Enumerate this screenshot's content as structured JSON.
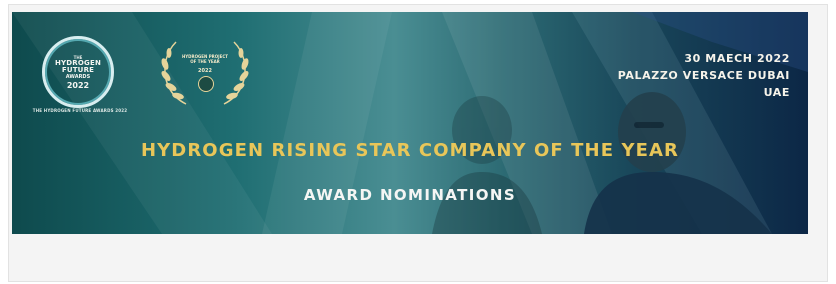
{
  "banner": {
    "logo": {
      "prefix": "THE",
      "line1": "HYDROGEN",
      "line2": "FUTURE",
      "line3": "AWARDS",
      "year": "2022",
      "caption": "THE HYDROGEN FUTURE AWARDS 2022"
    },
    "laurel": {
      "text": "HYDROGEN PROJECT OF THE YEAR",
      "year": "2022"
    },
    "event": {
      "date": "30 MAECH 2022",
      "venue": "PALAZZO VERSACE DUBAI",
      "country": "UAE"
    },
    "headline": "HYDROGEN RISING STAR COMPANY OF THE YEAR",
    "subheadline": "AWARD NOMINATIONS"
  },
  "colors": {
    "headline": "#e8c659",
    "accent_teal": "#1f6e72",
    "navy": "#0c2746"
  }
}
